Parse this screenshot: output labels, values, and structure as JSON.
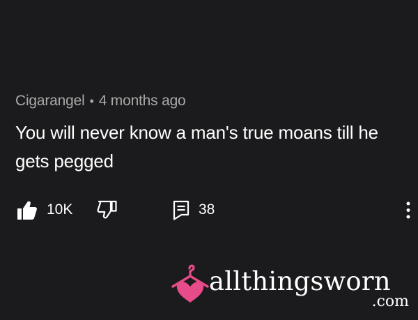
{
  "comment": {
    "author": "Cigarangel",
    "separator": "•",
    "timestamp": "4 months ago",
    "text": "You will never know a man's true moans till he gets pegged"
  },
  "actions": {
    "like_count": "10K",
    "reply_count": "38",
    "like_icon": "thumbs-up-icon",
    "dislike_icon": "thumbs-down-icon",
    "reply_icon": "reply-comment-icon",
    "more_icon": "more-vertical-icon"
  },
  "watermark": {
    "name": "allthingsworn",
    "domain": ".com",
    "logo": "hanger-heart-logo",
    "accent_color": "#e64b8a"
  },
  "colors": {
    "background": "#1b1a1c",
    "primary_text": "#ffffff",
    "secondary_text": "#a9a9a9"
  }
}
